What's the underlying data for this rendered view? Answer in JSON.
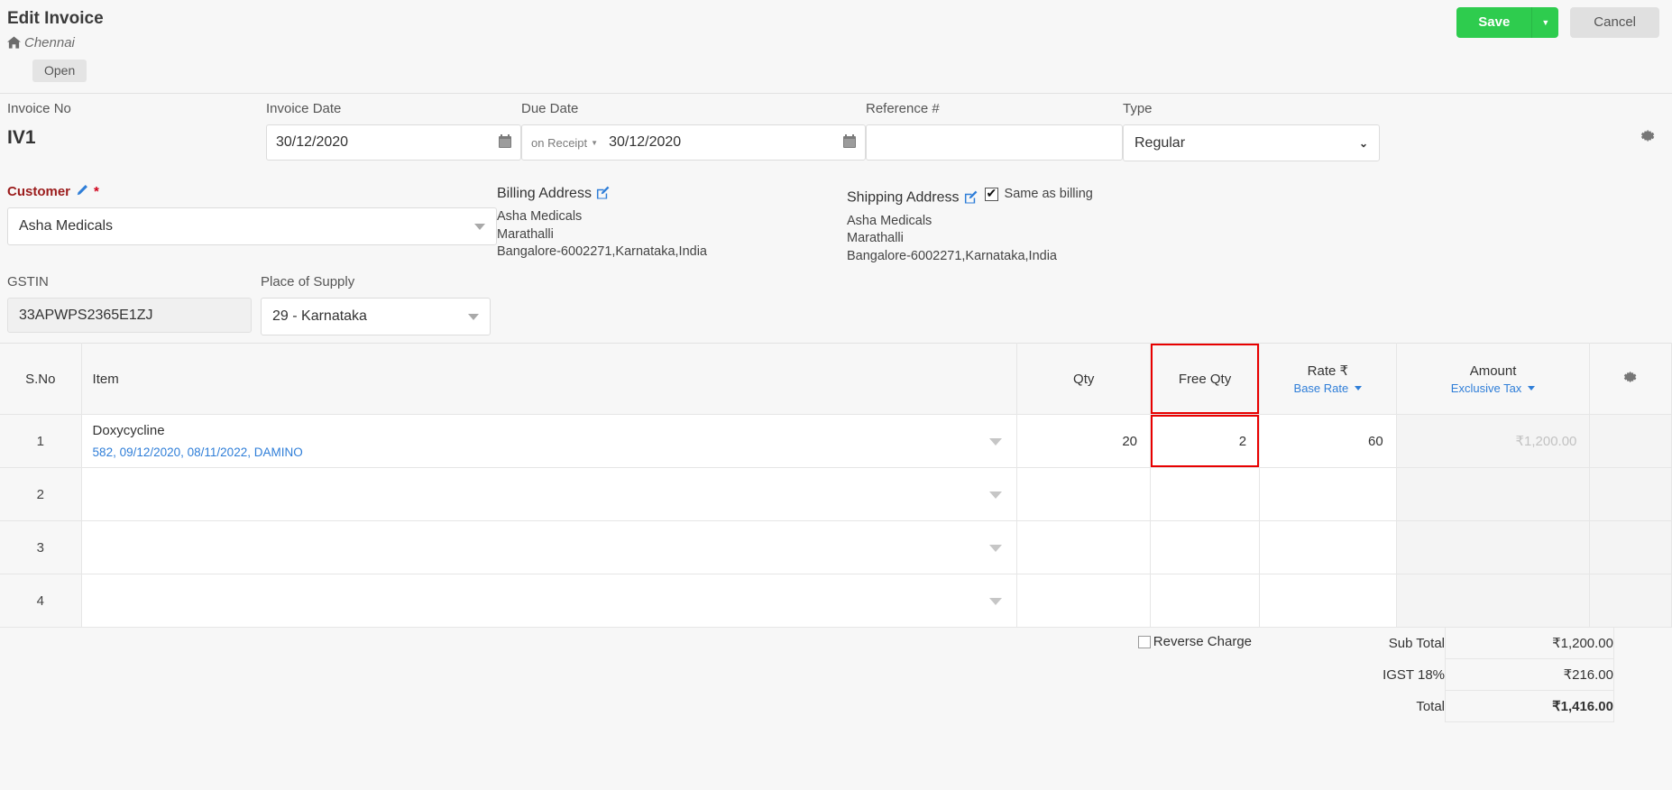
{
  "header": {
    "title": "Edit Invoice",
    "breadcrumb_location": "Chennai",
    "home_icon": "home-icon",
    "status_badge": "Open",
    "save_label": "Save",
    "save_caret_icon": "chevron-down-icon",
    "cancel_label": "Cancel",
    "accent_green": "#2ecc4e",
    "cancel_grey": "#e0e0e0"
  },
  "form": {
    "invoice_no": {
      "label": "Invoice No",
      "value": "IV1"
    },
    "invoice_date": {
      "label": "Invoice Date",
      "value": "30/12/2020",
      "icon": "calendar-icon"
    },
    "due_date": {
      "label": "Due Date",
      "term": "on Receipt",
      "value": "30/12/2020",
      "icon": "calendar-icon"
    },
    "reference": {
      "label": "Reference #",
      "value": "",
      "placeholder": ""
    },
    "type": {
      "label": "Type",
      "value": "Regular"
    },
    "settings_icon": "gear-icon"
  },
  "customer": {
    "label": "Customer",
    "edit_icon": "pencil-icon",
    "required_mark": "*",
    "value": "Asha Medicals",
    "label_color": "#9b1c1c"
  },
  "billing": {
    "title": "Billing Address",
    "edit_icon": "edit-square-icon",
    "lines": [
      "Asha Medicals",
      "Marathalli",
      "Bangalore-6002271,Karnataka,India"
    ]
  },
  "shipping": {
    "title": "Shipping Address",
    "edit_icon": "edit-square-icon",
    "same_as_billing_label": "Same as billing",
    "same_as_billing_checked": true,
    "lines": [
      "Asha Medicals",
      "Marathalli",
      "Bangalore-6002271,Karnataka,India"
    ]
  },
  "gstin": {
    "label": "GSTIN",
    "value": "33APWPS2365E1ZJ"
  },
  "place_of_supply": {
    "label": "Place of Supply",
    "value": "29 - Karnataka"
  },
  "items_table": {
    "columns": {
      "sno": "S.No",
      "item": "Item",
      "qty": "Qty",
      "free_qty": "Free Qty",
      "rate": "Rate ₹",
      "rate_sub": "Base Rate",
      "amount": "Amount",
      "amount_sub": "Exclusive Tax",
      "gear_icon": "gear-icon"
    },
    "highlight_color": "#e80000",
    "highlighted_column": "free_qty",
    "rows": [
      {
        "sno": "1",
        "item_name": "Doxycycline",
        "item_batch": "582, 09/12/2020, 08/11/2022, DAMINO",
        "qty": "20",
        "free_qty": "2",
        "rate": "60",
        "amount": "₹1,200.00"
      },
      {
        "sno": "2",
        "item_name": "",
        "item_batch": "",
        "qty": "",
        "free_qty": "",
        "rate": "",
        "amount": ""
      },
      {
        "sno": "3",
        "item_name": "",
        "item_batch": "",
        "qty": "",
        "free_qty": "",
        "rate": "",
        "amount": ""
      },
      {
        "sno": "4",
        "item_name": "",
        "item_batch": "",
        "qty": "",
        "free_qty": "",
        "rate": "",
        "amount": ""
      }
    ]
  },
  "totals": {
    "reverse_charge_label": "Reverse Charge",
    "reverse_charge_checked": false,
    "sub_total_label": "Sub Total",
    "sub_total_value": "₹1,200.00",
    "tax_label": "IGST 18%",
    "tax_value": "₹216.00",
    "total_label": "Total",
    "total_value": "₹1,416.00"
  }
}
